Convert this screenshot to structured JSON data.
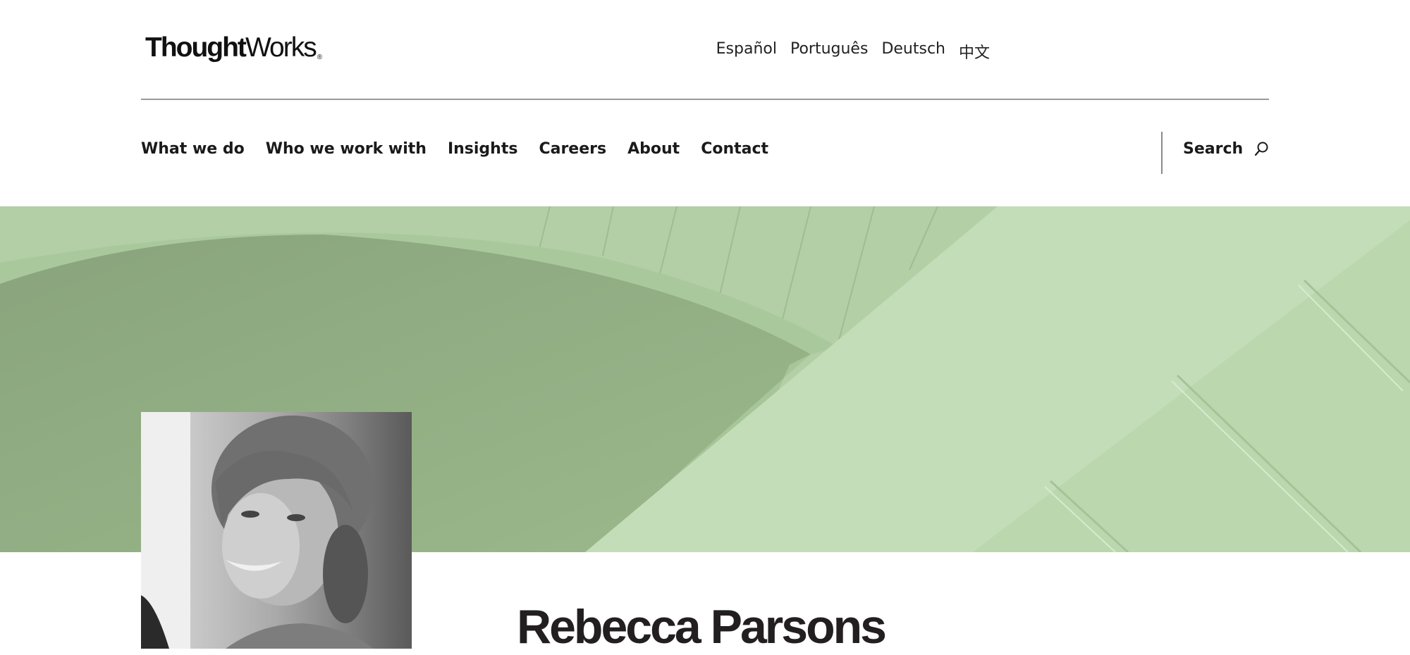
{
  "header": {
    "logo": {
      "part1": "Thought",
      "part2": "Works",
      "mark": "®"
    },
    "languages": [
      "Español",
      "Português",
      "Deutsch",
      "中文"
    ]
  },
  "nav": {
    "items": [
      "What we do",
      "Who we work with",
      "Insights",
      "Careers",
      "About",
      "Contact"
    ],
    "search_label": "Search",
    "search_icon": "magnifier"
  },
  "hero": {
    "colors": {
      "light": "#c3ddb9",
      "dark": "#8da77f"
    }
  },
  "profile": {
    "name": "Rebecca Parsons"
  }
}
